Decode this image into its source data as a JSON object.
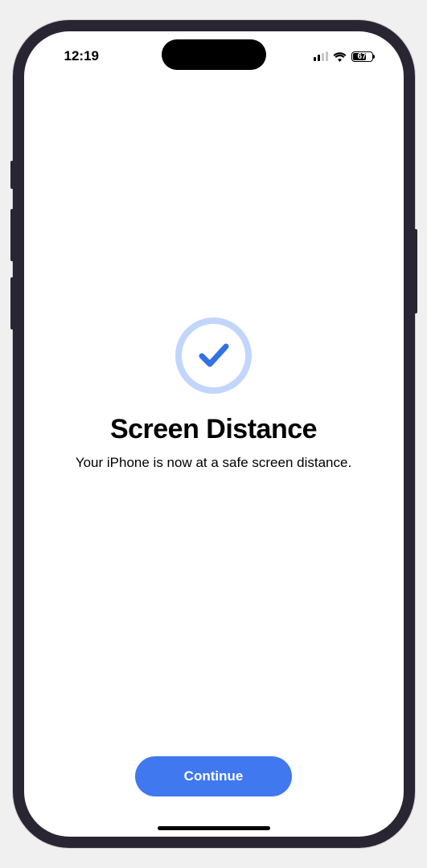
{
  "statusBar": {
    "time": "12:19",
    "batteryLevel": "67"
  },
  "content": {
    "title": "Screen Distance",
    "subtitle": "Your iPhone is now at a safe screen distance."
  },
  "button": {
    "continueLabel": "Continue"
  }
}
